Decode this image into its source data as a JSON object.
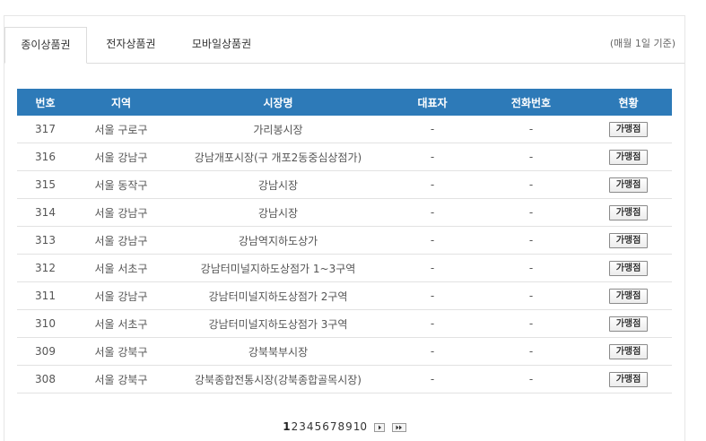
{
  "tabs": [
    {
      "label": "종이상품권",
      "active": true
    },
    {
      "label": "전자상품권",
      "active": false
    },
    {
      "label": "모바일상품권",
      "active": false
    }
  ],
  "tab_note": "(매월 1일 기준)",
  "table": {
    "headers": [
      "번호",
      "지역",
      "시장명",
      "대표자",
      "전화번호",
      "현황"
    ],
    "rows": [
      {
        "no": "317",
        "region": "서울 구로구",
        "market": "가리봉시장",
        "rep": "-",
        "phone": "-",
        "status": "가맹점"
      },
      {
        "no": "316",
        "region": "서울 강남구",
        "market": "강남개포시장(구 개포2동중심상점가)",
        "rep": "-",
        "phone": "-",
        "status": "가맹점"
      },
      {
        "no": "315",
        "region": "서울 동작구",
        "market": "강남시장",
        "rep": "-",
        "phone": "-",
        "status": "가맹점"
      },
      {
        "no": "314",
        "region": "서울 강남구",
        "market": "강남시장",
        "rep": "-",
        "phone": "-",
        "status": "가맹점"
      },
      {
        "no": "313",
        "region": "서울 강남구",
        "market": "강남역지하도상가",
        "rep": "-",
        "phone": "-",
        "status": "가맹점"
      },
      {
        "no": "312",
        "region": "서울 서초구",
        "market": "강남터미널지하도상점가 1~3구역",
        "rep": "-",
        "phone": "-",
        "status": "가맹점"
      },
      {
        "no": "311",
        "region": "서울 강남구",
        "market": "강남터미널지하도상점가 2구역",
        "rep": "-",
        "phone": "-",
        "status": "가맹점"
      },
      {
        "no": "310",
        "region": "서울 서초구",
        "market": "강남터미널지하도상점가 3구역",
        "rep": "-",
        "phone": "-",
        "status": "가맹점"
      },
      {
        "no": "309",
        "region": "서울 강북구",
        "market": "강북북부시장",
        "rep": "-",
        "phone": "-",
        "status": "가맹점"
      },
      {
        "no": "308",
        "region": "서울 강북구",
        "market": "강북종합전통시장(강북종합골목시장)",
        "rep": "-",
        "phone": "-",
        "status": "가맹점"
      }
    ]
  },
  "pagination": {
    "pages": [
      "1",
      "2",
      "3",
      "4",
      "5",
      "6",
      "7",
      "8",
      "9",
      "10"
    ],
    "current": "1",
    "next_icon": "next-page-icon",
    "last_icon": "last-page-icon"
  },
  "colors": {
    "header_bg": "#2d7ab8",
    "row_border": "#e2e2e2"
  }
}
